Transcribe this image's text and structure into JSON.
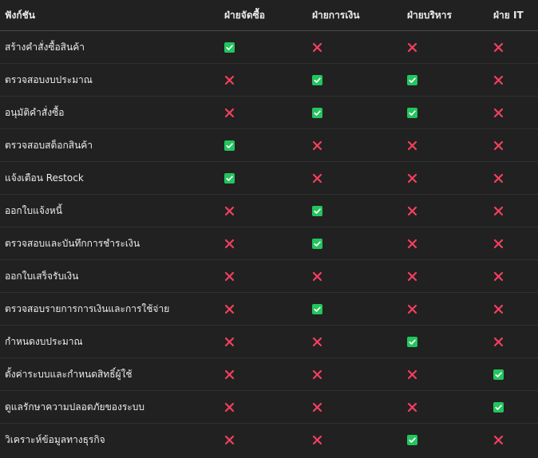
{
  "table": {
    "headers": [
      "ฟังก์ชัน",
      "ฝ่ายจัดซื้อ",
      "ฝ่ายการเงิน",
      "ฝ่ายบริหาร",
      "ฝ่าย IT"
    ],
    "rows": [
      {
        "function": "สร้างคำสั่งซื้อสินค้า",
        "marks": [
          "check",
          "cross",
          "cross",
          "cross"
        ]
      },
      {
        "function": "ตรวจสอบงบประมาณ",
        "marks": [
          "cross",
          "check",
          "check",
          "cross"
        ]
      },
      {
        "function": "อนุมัติคำสั่งซื้อ",
        "marks": [
          "cross",
          "check",
          "check",
          "cross"
        ]
      },
      {
        "function": "ตรวจสอบสต็อกสินค้า",
        "marks": [
          "check",
          "cross",
          "cross",
          "cross"
        ]
      },
      {
        "function": "แจ้งเตือน Restock",
        "marks": [
          "check",
          "cross",
          "cross",
          "cross"
        ]
      },
      {
        "function": "ออกใบแจ้งหนี้",
        "marks": [
          "cross",
          "check",
          "cross",
          "cross"
        ]
      },
      {
        "function": "ตรวจสอบและบันทึกการชำระเงิน",
        "marks": [
          "cross",
          "check",
          "cross",
          "cross"
        ]
      },
      {
        "function": "ออกใบเสร็จรับเงิน",
        "marks": [
          "cross",
          "cross",
          "cross",
          "cross"
        ]
      },
      {
        "function": "ตรวจสอบรายการการเงินและการใช้จ่าย",
        "marks": [
          "cross",
          "check",
          "cross",
          "cross"
        ]
      },
      {
        "function": "กำหนดงบประมาณ",
        "marks": [
          "cross",
          "cross",
          "check",
          "cross"
        ]
      },
      {
        "function": "ตั้งค่าระบบและกำหนดสิทธิ์ผู้ใช้",
        "marks": [
          "cross",
          "cross",
          "cross",
          "check"
        ]
      },
      {
        "function": "ดูแลรักษาความปลอดภัยของระบบ",
        "marks": [
          "cross",
          "cross",
          "cross",
          "check"
        ]
      },
      {
        "function": "วิเคราะห์ข้อมูลทางธุรกิจ",
        "marks": [
          "cross",
          "cross",
          "check",
          "cross"
        ]
      }
    ]
  },
  "icons": {
    "check": {
      "name": "check-mark-icon",
      "color": "#22c55e"
    },
    "cross": {
      "name": "cross-mark-icon",
      "color": "#f43f5e"
    }
  }
}
